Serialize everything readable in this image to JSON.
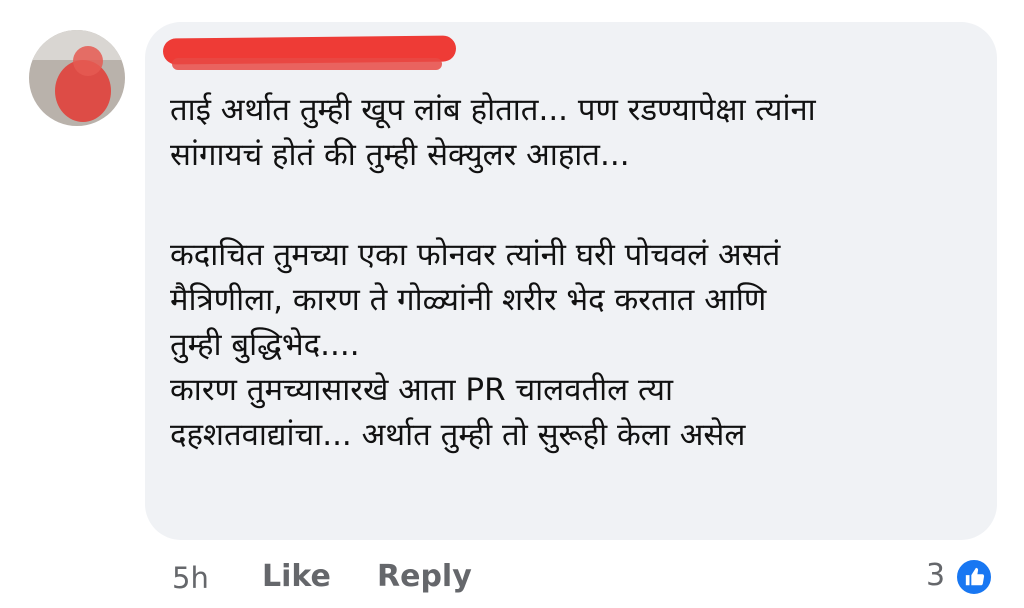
{
  "comment": {
    "author_redacted": true,
    "lines": [
      "ताई अर्थात तुम्ही खूप लांब होतात... पण रडण्यापेक्षा त्यांना",
      "सांगायचं होतं की तुम्ही सेक्युलर आहात...",
      "",
      "कदाचित तुमच्या एका फोनवर त्यांनी घरी पोचवलं असतं",
      "मैत्रिणीला, कारण ते गोळ्यांनी शरीर भेद करतात आणि",
      "तुम्ही बुद्धिभेद....",
      "कारण तुमच्यासारखे आता PR चालवतील त्या",
      "दहशतवाद्यांचा... अर्थात तुम्ही तो सुरूही केला असेल"
    ]
  },
  "footer": {
    "time": "5h",
    "like_label": "Like",
    "reply_label": "Reply",
    "reaction_count": "3",
    "reaction_icon": "thumbs-up-icon"
  },
  "colors": {
    "bubble": "#f0f2f5",
    "like_blue": "#1877f2",
    "meta_gray": "#65676b",
    "redaction": "#ee3b36"
  }
}
